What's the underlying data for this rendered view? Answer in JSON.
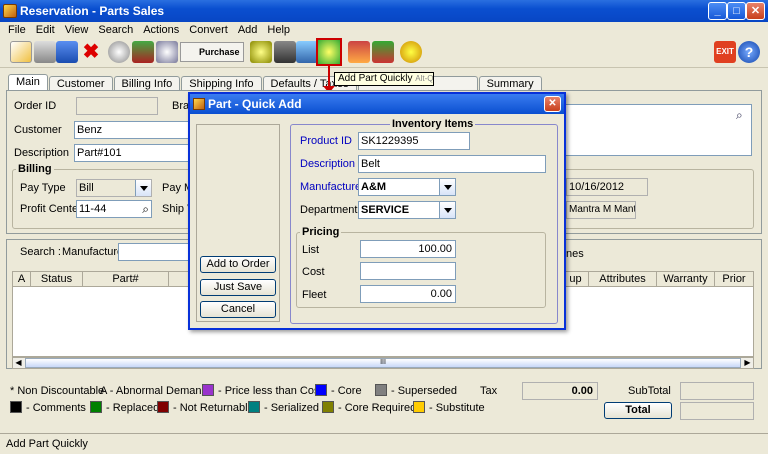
{
  "window": {
    "title": "Reservation - Parts Sales"
  },
  "menu": [
    "File",
    "Edit",
    "View",
    "Search",
    "Actions",
    "Convert",
    "Add",
    "Help"
  ],
  "toolbar": {
    "purchase_label": "Purchase",
    "exit_label": "EXIT",
    "tooltip": "Add Part Quickly",
    "tooltip_shortcut": "Alt-Q"
  },
  "tabs": [
    "Main",
    "Customer",
    "Billing Info",
    "Shipping Info",
    "Defaults / Taxes",
    "",
    "Summary"
  ],
  "main": {
    "order_id_label": "Order ID",
    "br_label": "Bra",
    "customer_label": "Customer",
    "customer_value": "Benz",
    "description_label": "Description",
    "description_value": "Part#101",
    "billing_title": "Billing",
    "pay_type_label": "Pay Type",
    "pay_type_value": "Bill",
    "pay_m_label": "Pay M",
    "profit_center_label": "Profit Center",
    "profit_center_value": "11-44",
    "ship_v_label": "Ship V",
    "date_value": "10/16/2012",
    "mantra_value": "Mantra M Mantra"
  },
  "search": {
    "label": "Search :",
    "manufacturer_label": "Manufacturer",
    "lines_label": "nes"
  },
  "grid": {
    "columns": [
      "A",
      "Status",
      "Part#",
      "",
      "up",
      "Attributes",
      "Warranty",
      "Prior"
    ],
    "scroll_mark": "III"
  },
  "legend": {
    "items_row1": [
      "* Non Discountable",
      "A - Abnormal Demand",
      "- Price less than Cost",
      "- Core",
      "- Superseded"
    ],
    "items_row2": [
      "- Comments",
      "- Replaced",
      "- Not Returnable",
      "- Serialized",
      "- Core Required",
      "- Substitute"
    ],
    "colors_row1": [
      "#9933cc",
      "#0000ff",
      "#808080"
    ],
    "colors_row2": [
      "#000000",
      "#008000",
      "#800000",
      "#008080",
      "#808000",
      "#ffcc00"
    ]
  },
  "totals": {
    "tax_label": "Tax",
    "tax_value": "0.00",
    "subtotal_label": "SubTotal",
    "total_label": "Total"
  },
  "status": "Add Part Quickly",
  "dialog": {
    "title": "Part - Quick Add",
    "buttons": {
      "add": "Add to Order",
      "save": "Just Save",
      "cancel": "Cancel"
    },
    "inventory_title": "Inventory Items",
    "product_id_label": "Product ID",
    "product_id_value": "SK1229395",
    "description_label": "Description",
    "description_value": "Belt",
    "manufacturer_label": "Manufacturer",
    "manufacturer_value": "A&M",
    "department_label": "Department",
    "department_value": "SERVICE",
    "pricing_title": "Pricing",
    "list_label": "List",
    "list_value": "100.00",
    "cost_label": "Cost",
    "cost_value": "",
    "fleet_label": "Fleet",
    "fleet_value": "0.00"
  }
}
